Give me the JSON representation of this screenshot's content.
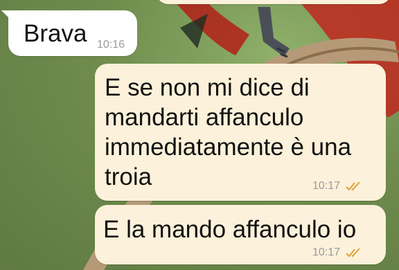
{
  "messages": [
    {
      "id": "m1",
      "direction": "incoming",
      "text": "Brava",
      "time": "10:16"
    },
    {
      "id": "m2",
      "direction": "outgoing",
      "text": "E se non mi dice di\nmandarti affanculo\nimmediatamente è una\ntroia",
      "time": "10:17",
      "status_icon": "double-check-read-icon"
    },
    {
      "id": "m3",
      "direction": "outgoing",
      "text": "E la mando affanculo io",
      "time": "10:17",
      "status_icon": "double-check-read-icon"
    }
  ],
  "colors": {
    "incoming_bubble": "#ffffff",
    "outgoing_bubble": "#fcf1da",
    "timestamp": "#9a9a9a",
    "read_ticks": "#e0a23a"
  }
}
